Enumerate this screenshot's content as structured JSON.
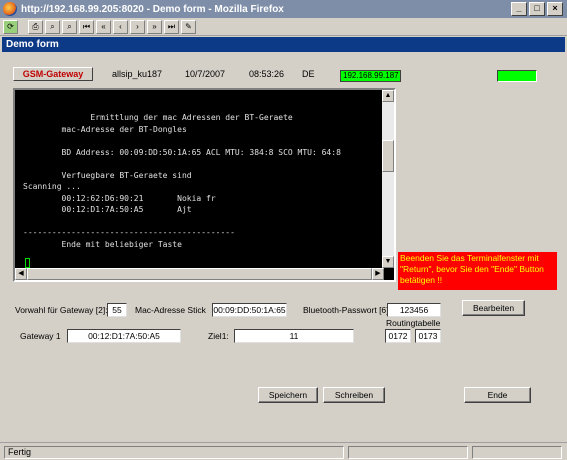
{
  "window": {
    "title": "http://192.168.99.205:8020 - Demo form - Mozilla Firefox",
    "buttons": [
      "_",
      "□",
      "×"
    ]
  },
  "toolbar": {
    "icons": [
      "reload-icon",
      "print-icon",
      "find-icon",
      "find-next-icon",
      "first-icon",
      "previous-icon",
      "back-icon",
      "forward-icon",
      "next-icon",
      "last-icon",
      "edit-icon"
    ],
    "glyphs": [
      "⟳",
      "⎙",
      "⌕",
      "⌕",
      "⏮",
      "«",
      "‹",
      "›",
      "»",
      "⏭",
      "✎"
    ]
  },
  "header": {
    "title": "Demo form"
  },
  "info": {
    "gsm_button": "GSM-Gateway",
    "user": "allsip_ku187",
    "date": "10/7/2007",
    "time": "08:53:26",
    "lang": "DE",
    "ip": "192.168.99.187",
    "colors": {
      "ip_bg": "#00ff00",
      "led": "#00ff00"
    }
  },
  "terminal": {
    "lines": [
      "              Ermittlung der mac Adressen der BT-Geraete",
      "        mac-Adresse der BT-Dongles",
      "",
      "        BD Address: 00:09:DD:50:1A:65 ACL MTU: 384:8 SCO MTU: 64:8",
      "",
      "        Verfuegbare BT-Geraete sind",
      "Scanning ...",
      "        00:12:62:D6:90:21       Nokia fr",
      "        00:12:D1:7A:50:A5       Ajt",
      "",
      "--------------------------------------------",
      "        Ende mit beliebiger Taste"
    ]
  },
  "warning": {
    "text": "Beenden Sie das Terminalfenster mit \"Return\", bevor Sie den \"Ende\" Button betätigen !!",
    "colors": {
      "bg": "#ff0000",
      "fg": "#ffff00"
    }
  },
  "form": {
    "vorwahl_label": "Vorwahl für Gateway [2]:",
    "vorwahl_value": "55",
    "mac_label": "Mac-Adresse Stick",
    "mac_value": "00:09:DD:50:1A:65",
    "bt_label": "Bluetooth-Passwort [6]:",
    "bt_value": "123456",
    "bearbeiten": "Bearbeiten",
    "gateway_label": "Gateway 1",
    "gateway_value": "00:12:D1:7A:50:A5",
    "ziel_label": "Ziel1:",
    "ziel_value": "11",
    "routing_label": "Routingtabelle",
    "routing_a": "0172",
    "routing_b": "0173"
  },
  "buttons": {
    "speichern": "Speichern",
    "schreiben": "Schreiben",
    "ende": "Ende"
  },
  "status": {
    "text": "Fertig"
  }
}
